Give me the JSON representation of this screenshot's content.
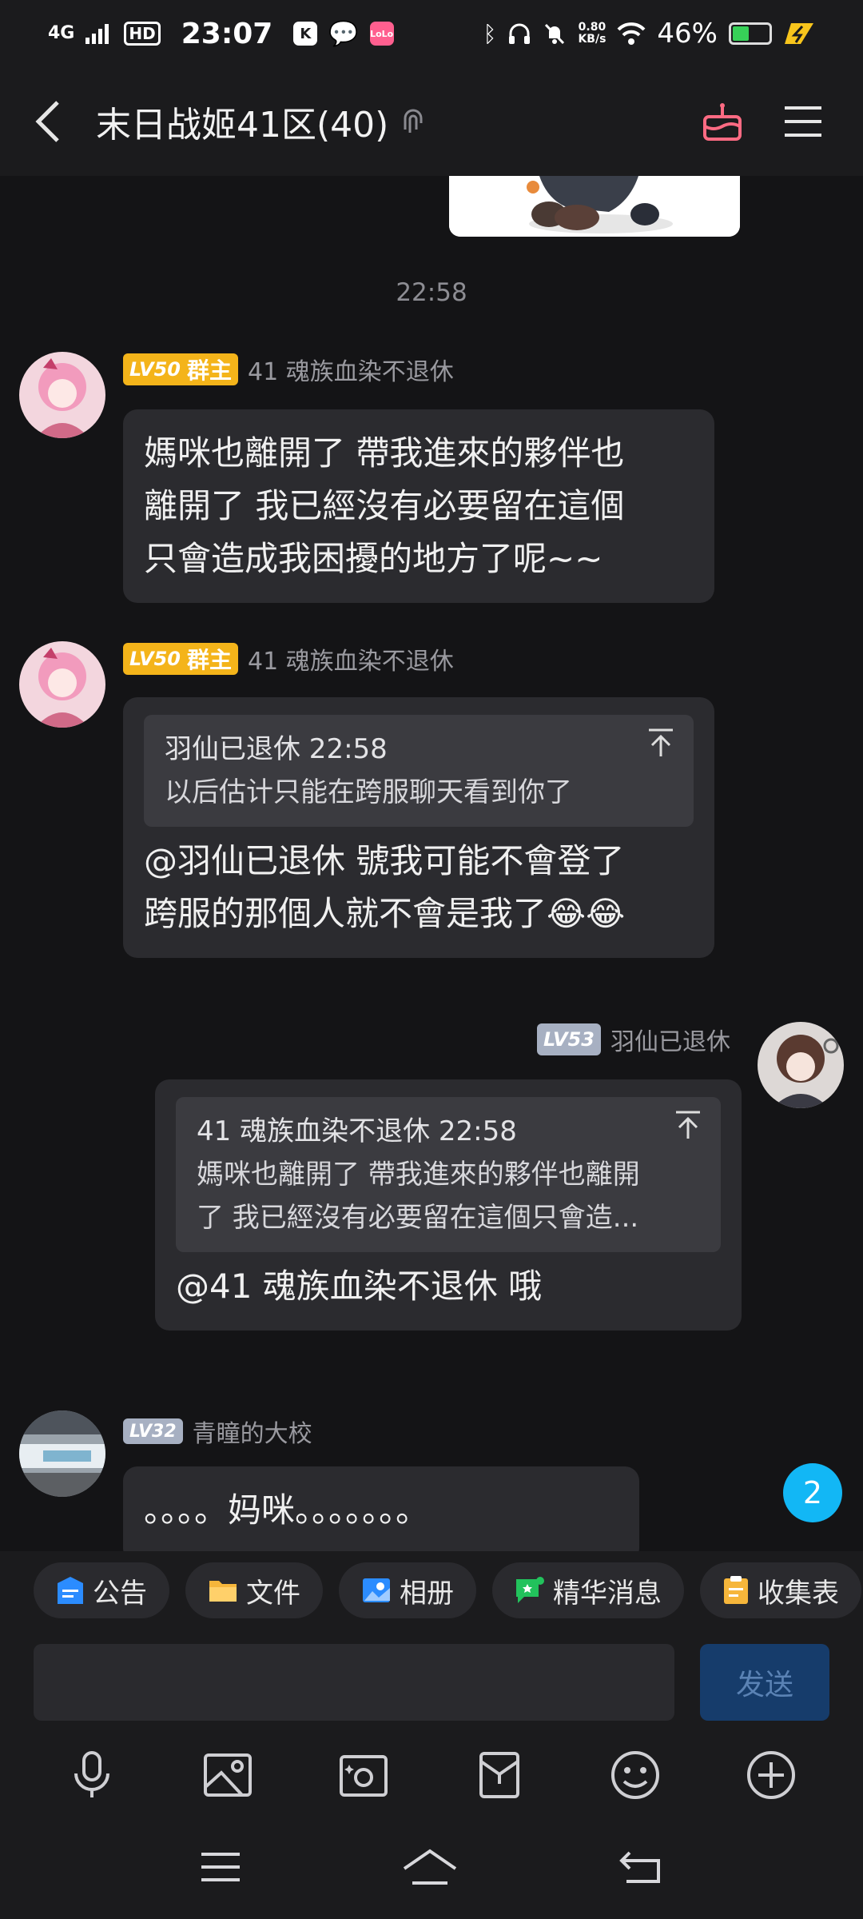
{
  "status_bar": {
    "network": "4G",
    "hd": "HD",
    "time": "23:07",
    "net_speed_value": "0.80",
    "net_speed_unit": "KB/s",
    "battery": "46%",
    "battery_level": 0.46
  },
  "header": {
    "title": "末日战姬41区(40)"
  },
  "chat": {
    "timestamp": "22:58",
    "messages": [
      {
        "level": "LV50",
        "role": "群主",
        "sender": "41 魂族血染不退休",
        "lines": [
          "媽咪也離開了 帶我進來的夥伴也",
          "離開了 我已經沒有必要留在這個",
          "只會造成我困擾的地方了呢~~"
        ]
      },
      {
        "level": "LV50",
        "role": "群主",
        "sender": "41 魂族血染不退休",
        "quote_header": "羽仙已退休 22:58",
        "quote_text": "以后估计只能在跨服聊天看到你了",
        "lines": [
          "@羽仙已退休 號我可能不會登了",
          "跨服的那個人就不會是我了😂😂"
        ]
      },
      {
        "level": "LV53",
        "sender": "羽仙已退休",
        "quote_header": "41 魂族血染不退休 22:58",
        "quote_lines": [
          "媽咪也離開了 帶我進來的夥伴也離開",
          "了 我已經沒有必要留在這個只會造..."
        ],
        "lines": [
          "@41 魂族血染不退休 哦"
        ]
      },
      {
        "level": "LV32",
        "sender": "青瞳的大校",
        "lines": [
          "。。。。妈咪。。。。。。。"
        ]
      }
    ],
    "unread_count": "2"
  },
  "quick_actions": [
    {
      "label": "公告",
      "icon": "announcement-icon"
    },
    {
      "label": "文件",
      "icon": "folder-icon"
    },
    {
      "label": "相册",
      "icon": "album-icon"
    },
    {
      "label": "精华消息",
      "icon": "essence-icon"
    },
    {
      "label": "收集表",
      "icon": "clipboard-icon"
    }
  ],
  "input": {
    "value": "",
    "send_label": "发送"
  },
  "colors": {
    "background": "#141416",
    "bubble": "#2b2b2f",
    "accent_blue": "#12b7f5",
    "owner_gold": "#f4b41a"
  }
}
